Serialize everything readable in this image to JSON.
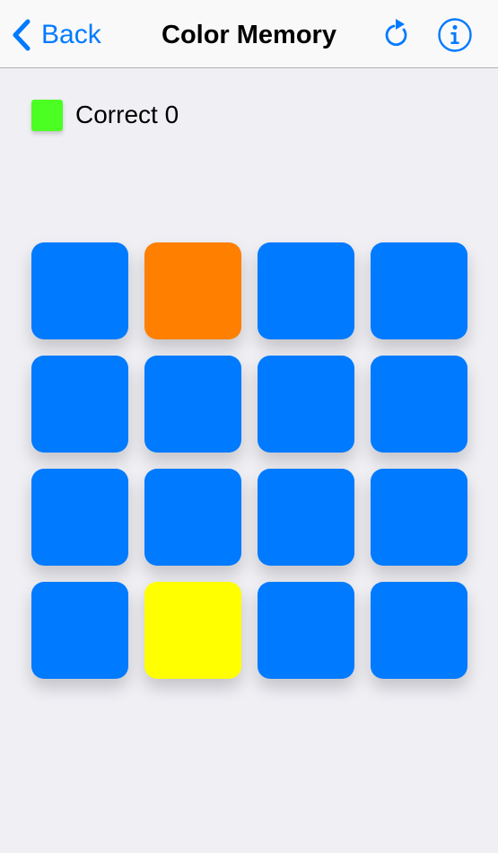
{
  "nav": {
    "back_label": "Back",
    "title": "Color Memory",
    "accent": "#007AFF",
    "icons": {
      "back": "chevron-left-icon",
      "refresh": "refresh-icon",
      "info": "info-icon"
    }
  },
  "status": {
    "correct_label": "Correct 0",
    "indicator_color": "#4CFF22"
  },
  "grid": {
    "rows": 4,
    "columns": 4,
    "tiles": [
      "#007AFF",
      "#FF7F00",
      "#007AFF",
      "#007AFF",
      "#007AFF",
      "#007AFF",
      "#007AFF",
      "#007AFF",
      "#007AFF",
      "#007AFF",
      "#007AFF",
      "#007AFF",
      "#007AFF",
      "#FFFF00",
      "#007AFF",
      "#007AFF"
    ]
  }
}
